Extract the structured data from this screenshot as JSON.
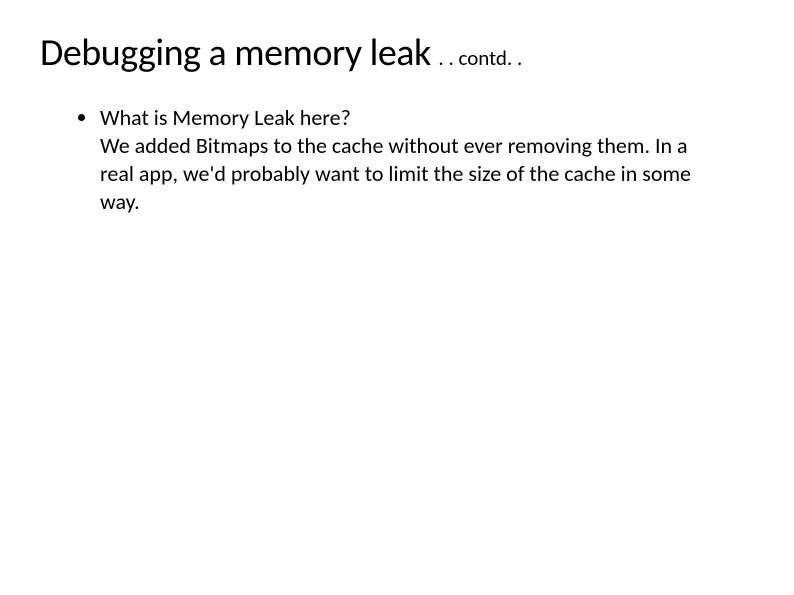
{
  "title": {
    "main": "Debugging a memory leak",
    "suffix": ". . contd. ."
  },
  "body": {
    "items": [
      {
        "question": "What is Memory Leak here?",
        "answer": "We added Bitmaps to the cache without ever removing them. In a real app, we'd probably want to limit the size of the cache in some way."
      }
    ]
  }
}
